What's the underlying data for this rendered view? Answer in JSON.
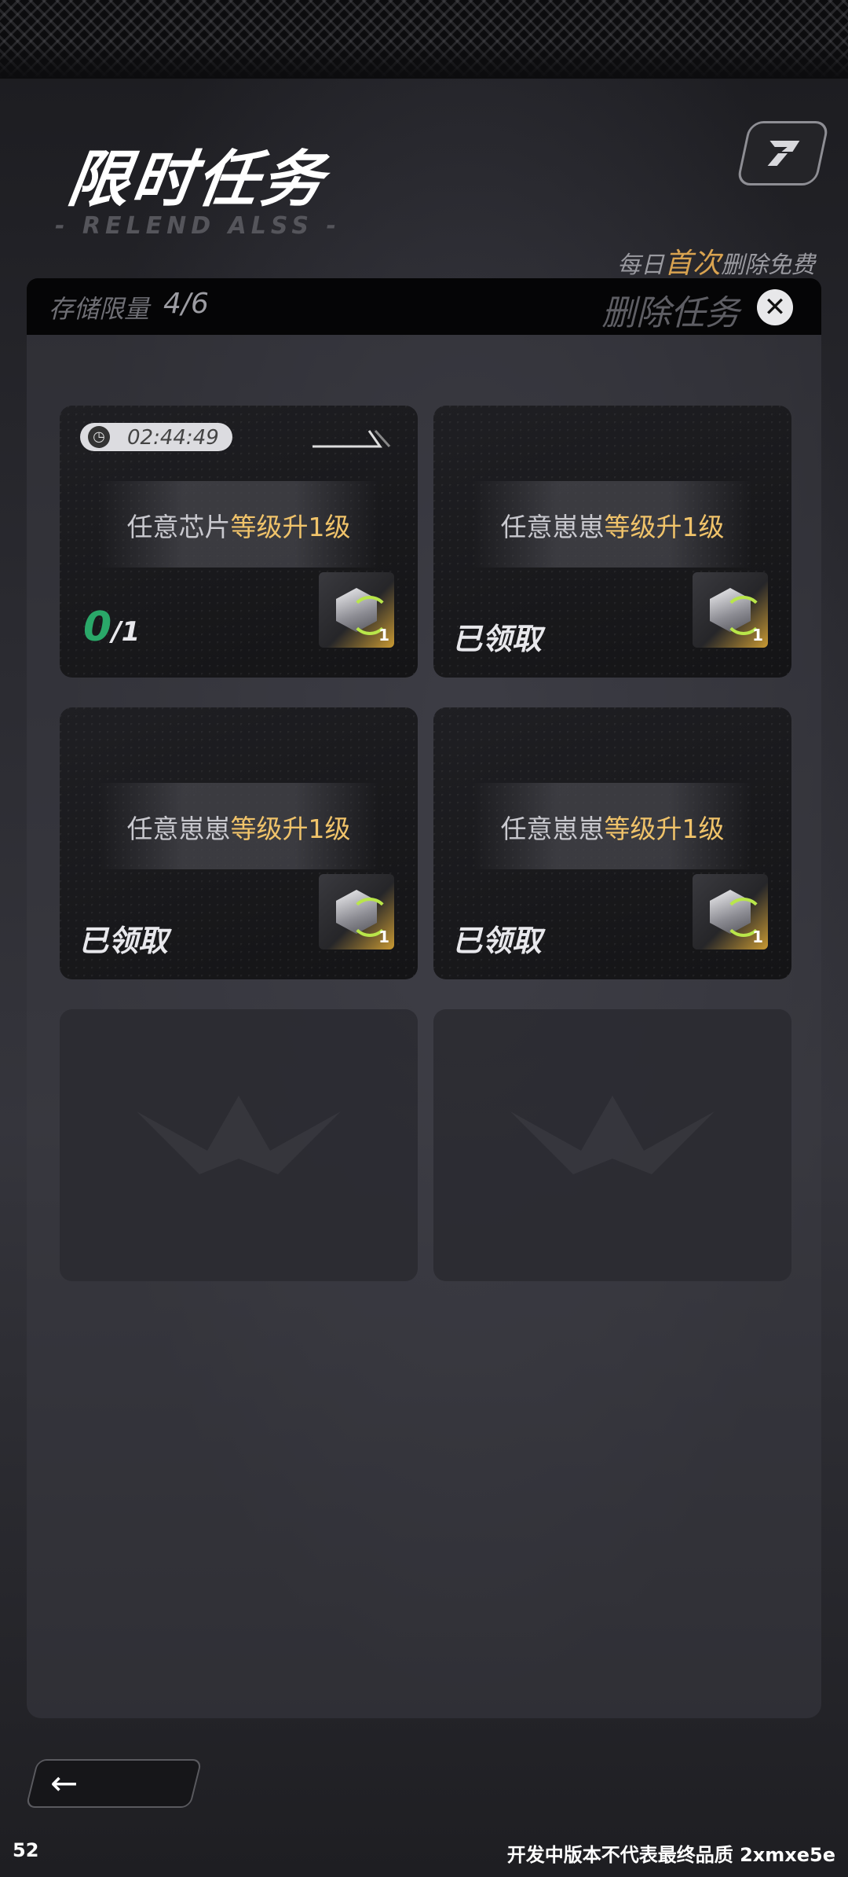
{
  "header": {
    "title": "限时任务",
    "subtitle": "- RELEND ALSS -"
  },
  "free_note": {
    "prefix": "每日",
    "highlight": "首次",
    "suffix": "删除免费"
  },
  "storage": {
    "label": "存储限量",
    "count": "4/6",
    "delete_label": "删除任务",
    "delete_icon": "close-icon"
  },
  "tasks": [
    {
      "timer": "02:44:49",
      "task_prefix": "任意芯片",
      "task_highlight": "等级升1级",
      "progress_current": "0",
      "progress_total": "/1",
      "reward_qty": "1"
    },
    {
      "task_prefix": "任意崽崽",
      "task_highlight": "等级升1级",
      "status": "已领取",
      "reward_qty": "1"
    },
    {
      "task_prefix": "任意崽崽",
      "task_highlight": "等级升1级",
      "status": "已领取",
      "reward_qty": "1"
    },
    {
      "task_prefix": "任意崽崽",
      "task_highlight": "等级升1级",
      "status": "已领取",
      "reward_qty": "1"
    }
  ],
  "footer": {
    "fps": "52",
    "dev_note": "开发中版本不代表最终品质 2xmxe5e"
  },
  "colors": {
    "highlight_gold": "#f0c36a",
    "progress_green": "#2aa869",
    "note_orange": "#d9a350"
  }
}
